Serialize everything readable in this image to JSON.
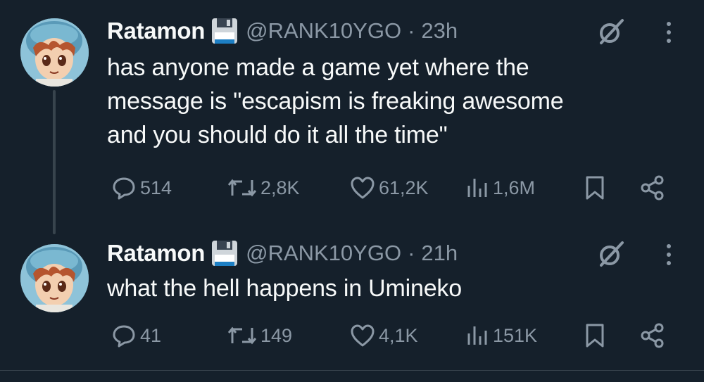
{
  "tweets": [
    {
      "display_name": "Ratamon",
      "badge_icon": "floppy-disk-icon",
      "handle": "@RANK10YGO",
      "separator": "·",
      "time": "23h",
      "text": "has anyone made a game yet where the\nmessage is \"escapism is freaking awesome\nand you should do it all the time\"",
      "actions": {
        "replies": "514",
        "retweets": "2,8K",
        "likes": "61,2K",
        "views": "1,6M"
      }
    },
    {
      "display_name": "Ratamon",
      "badge_icon": "floppy-disk-icon",
      "handle": "@RANK10YGO",
      "separator": "·",
      "time": "21h",
      "text": "what the hell happens in Umineko",
      "actions": {
        "replies": "41",
        "retweets": "149",
        "likes": "4,1K",
        "views": "151K"
      }
    }
  ],
  "colors": {
    "background": "#15202b",
    "primary_text": "#f7f9f9",
    "secondary_text": "#8b98a5",
    "thread_line": "#38444d"
  }
}
